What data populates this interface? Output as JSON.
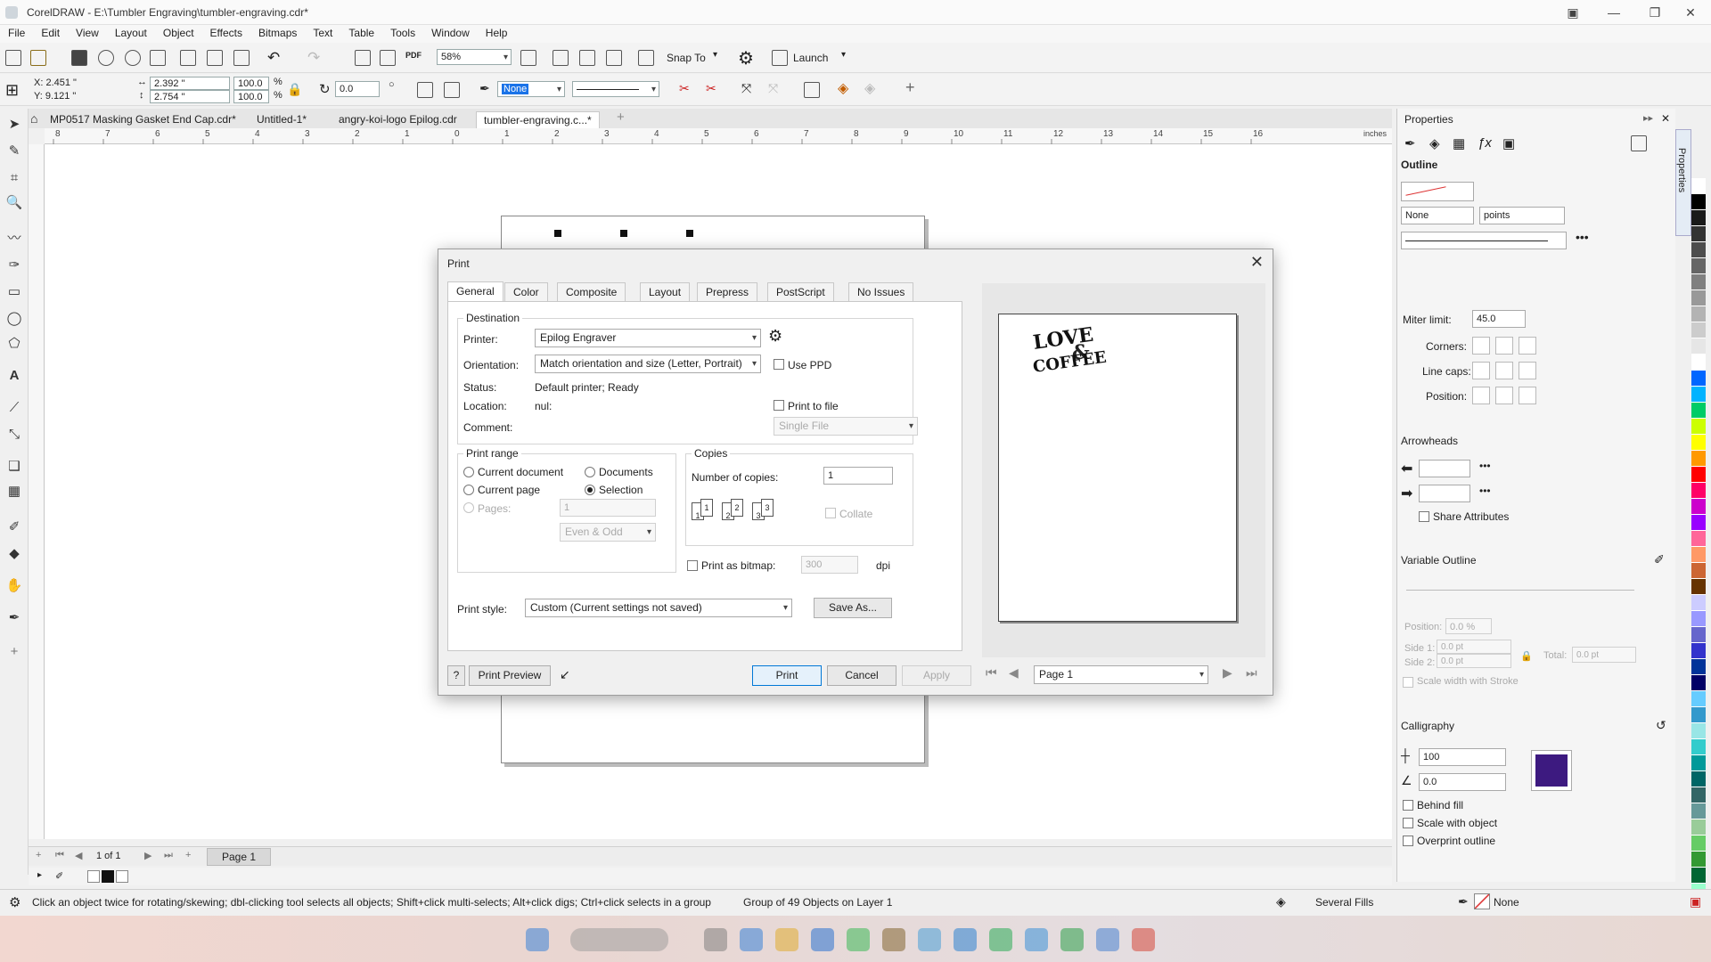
{
  "window": {
    "title": "CorelDRAW - E:\\Tumbler Engraving\\tumbler-engraving.cdr*",
    "minimize": "—",
    "restore": "❐",
    "close": "✕"
  },
  "menu": [
    "File",
    "Edit",
    "View",
    "Layout",
    "Object",
    "Effects",
    "Bitmaps",
    "Text",
    "Table",
    "Tools",
    "Window",
    "Help"
  ],
  "toolbar": {
    "zoom": "58%",
    "snap_to": "Snap To",
    "launch": "Launch"
  },
  "propbar": {
    "x": "X: 2.451 \"",
    "y": "Y: 9.121 \"",
    "w": "2.392 \"",
    "h": "2.754 \"",
    "sx": "100.0",
    "sy": "100.0",
    "pct1": "%",
    "pct2": "%",
    "rotation": "0.0",
    "outline": "None"
  },
  "doc_tabs": [
    {
      "label": "MP0517 Masking Gasket End Cap.cdr*"
    },
    {
      "label": "Untitled-1*"
    },
    {
      "label": "angry-koi-logo Epilog.cdr"
    },
    {
      "label": "tumbler-engraving.c...*"
    }
  ],
  "ruler": {
    "unit": "inches",
    "ticks": [
      "8",
      "7",
      "6",
      "5",
      "4",
      "3",
      "2",
      "1",
      "0",
      "1",
      "2",
      "3",
      "4",
      "5",
      "6",
      "7",
      "8",
      "9",
      "10",
      "11",
      "12",
      "13",
      "14",
      "15",
      "16"
    ]
  },
  "dialog": {
    "title": "Print",
    "tabs": [
      "General",
      "Color",
      "Composite",
      "Layout",
      "Prepress",
      "PostScript",
      "No Issues"
    ],
    "destination": {
      "group_label": "Destination",
      "printer_label": "Printer:",
      "printer_value": "Epilog Engraver",
      "orientation_label": "Orientation:",
      "orientation_value": "Match orientation and size (Letter, Portrait)",
      "use_ppd": "Use PPD",
      "status_label": "Status:",
      "status_value": "Default printer; Ready",
      "location_label": "Location:",
      "location_value": "nul:",
      "print_to_file": "Print to file",
      "comment_label": "Comment:",
      "file_mode": "Single File"
    },
    "print_range": {
      "group_label": "Print range",
      "current_document": "Current document",
      "documents": "Documents",
      "current_page": "Current page",
      "selection": "Selection",
      "pages_label": "Pages:",
      "pages_value": "1",
      "even_odd": "Even & Odd"
    },
    "copies": {
      "group_label": "Copies",
      "number_label": "Number of copies:",
      "number_value": "1",
      "collate": "Collate",
      "icons": [
        "1",
        "1",
        "2",
        "2",
        "3",
        "3"
      ]
    },
    "bitmap": {
      "label": "Print as bitmap:",
      "dpi_value": "300",
      "dpi_unit": "dpi"
    },
    "print_style": {
      "label": "Print style:",
      "value": "Custom (Current settings not saved)",
      "save_as": "Save As..."
    },
    "buttons": {
      "help": "?",
      "print_preview": "Print Preview",
      "print": "Print",
      "cancel": "Cancel",
      "apply": "Apply"
    },
    "preview": {
      "page_select": "Page 1",
      "artwork_line1": "LOVE",
      "artwork_amp": "&",
      "artwork_line2": "COFFEE"
    }
  },
  "properties": {
    "title": "Properties",
    "side_tab": "Properties",
    "outline_label": "Outline",
    "width_value": "None",
    "units_value": "points",
    "miter_label": "Miter limit:",
    "miter_value": "45.0",
    "corners_label": "Corners:",
    "linecaps_label": "Line caps:",
    "position_label": "Position:",
    "arrowheads_label": "Arrowheads",
    "share_attributes": "Share Attributes",
    "variable_outline_label": "Variable Outline",
    "vo_position_label": "Position:",
    "vo_position_value": "0.0 %",
    "side1_label": "Side 1:",
    "side1_value": "0.0 pt",
    "side2_label": "Side 2:",
    "side2_value": "0.0 pt",
    "total_label": "Total:",
    "total_value": "0.0 pt",
    "scale_stroke": "Scale width with Stroke",
    "calligraphy_label": "Calligraphy",
    "stretch_value": "100",
    "angle_value": "0.0",
    "calligraphy_color": "#3d1a80",
    "behind_fill": "Behind fill",
    "scale_with_object": "Scale with object",
    "overprint_outline": "Overprint outline"
  },
  "page_nav": {
    "counter": "1 of 1",
    "page_tab": "Page 1"
  },
  "status": {
    "hint": "Click an object twice for rotating/skewing; dbl-clicking tool selects all objects; Shift+click multi-selects; Alt+click digs; Ctrl+click selects in a group",
    "selection": "Group of 49 Objects on Layer 1",
    "fill": "Several Fills",
    "outline": "None"
  },
  "palette_colors": [
    "#ffffff",
    "#000000",
    "#1a1a1a",
    "#333333",
    "#4d4d4d",
    "#666666",
    "#808080",
    "#999999",
    "#b3b3b3",
    "#cccccc",
    "#e6e6e6",
    "#ffffff",
    "#0066ff",
    "#00b3ff",
    "#00cc66",
    "#ccff00",
    "#ffff00",
    "#ff9900",
    "#ff0000",
    "#ff0066",
    "#cc00cc",
    "#9900ff",
    "#ff6699",
    "#ff9966",
    "#cc6633",
    "#663300",
    "#ccccff",
    "#9999ff",
    "#6666cc",
    "#3333cc",
    "#003399",
    "#000066",
    "#66ccff",
    "#3399cc",
    "#99e6e6",
    "#33cccc",
    "#009999",
    "#006666",
    "#336666",
    "#669999",
    "#99cc99",
    "#66cc66",
    "#339933",
    "#006633",
    "#99ffcc"
  ]
}
